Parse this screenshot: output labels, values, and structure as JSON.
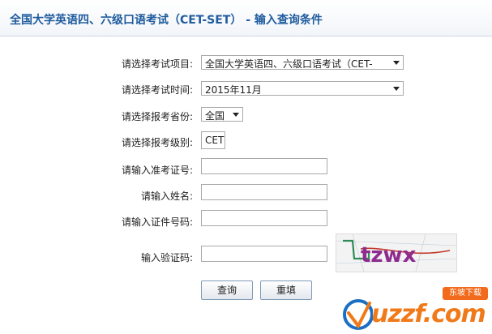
{
  "header": {
    "title": "全国大学英语四、六级口语考试（CET-SET） - 输入查询条件"
  },
  "form": {
    "exam_item": {
      "label": "请选择考试项目:",
      "value": "全国大学英语四、六级口语考试（CET-"
    },
    "exam_time": {
      "label": "请选择考试时间:",
      "value": "2015年11月"
    },
    "province": {
      "label": "请选择报考省份:",
      "value": "全国"
    },
    "level": {
      "label": "请选择报考级别:",
      "value": "CET"
    },
    "ticket_no": {
      "label": "请输入准考证号:",
      "value": ""
    },
    "name": {
      "label": "请输入姓名:",
      "value": ""
    },
    "id_no": {
      "label": "请输入证件号码:",
      "value": ""
    },
    "captcha": {
      "label": "输入验证码:",
      "value": "",
      "image_text": "tzwx"
    }
  },
  "buttons": {
    "query": "查询",
    "reset": "重填"
  },
  "watermark": {
    "text": "uzzf.com",
    "tag": "东坡下载"
  },
  "colors": {
    "title": "#1f5b9e",
    "watermark": "#f07a1a"
  }
}
